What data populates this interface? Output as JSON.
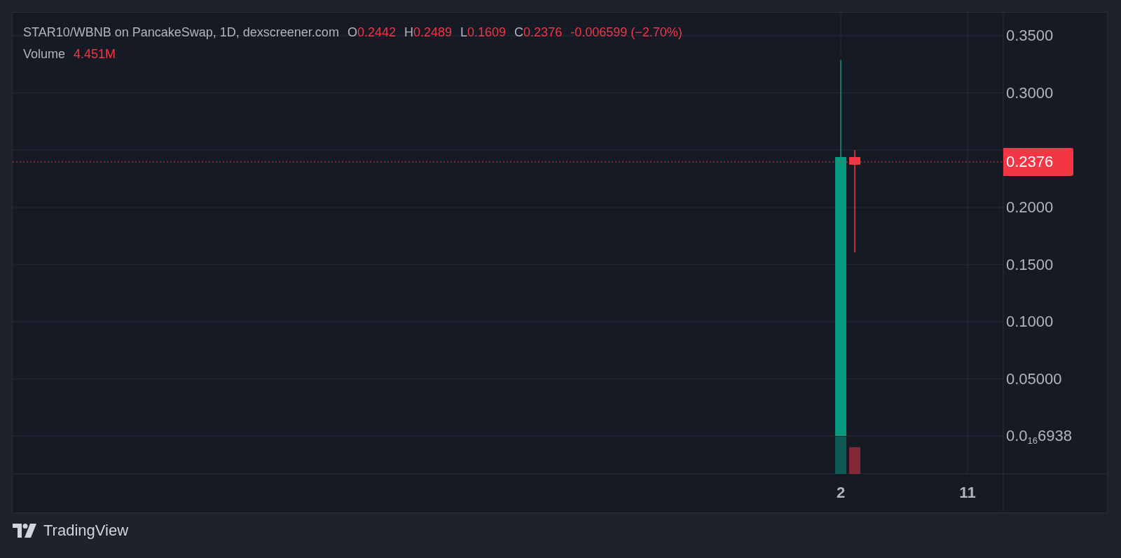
{
  "legend": {
    "symbol": "STAR10/WBNB on PancakeSwap, 1D, dexscreener.com",
    "ohlc": [
      {
        "key": "O",
        "value": "0.2442"
      },
      {
        "key": "H",
        "value": "0.2489"
      },
      {
        "key": "L",
        "value": "0.1609"
      },
      {
        "key": "C",
        "value": "0.2376"
      }
    ],
    "change": "-0.006599 (−2.70%)",
    "volume_label": "Volume",
    "volume_value": "4.451M"
  },
  "price_axis": {
    "labels": [
      "0.3500",
      "0.3000",
      "0.2000",
      "0.1500",
      "0.1000",
      "0.05000",
      "0.0$_{16}$6938"
    ],
    "last_price": "0.2376"
  },
  "time_axis": {
    "labels": [
      "2",
      "11"
    ]
  },
  "footer": {
    "brand": "TradingView"
  }
}
